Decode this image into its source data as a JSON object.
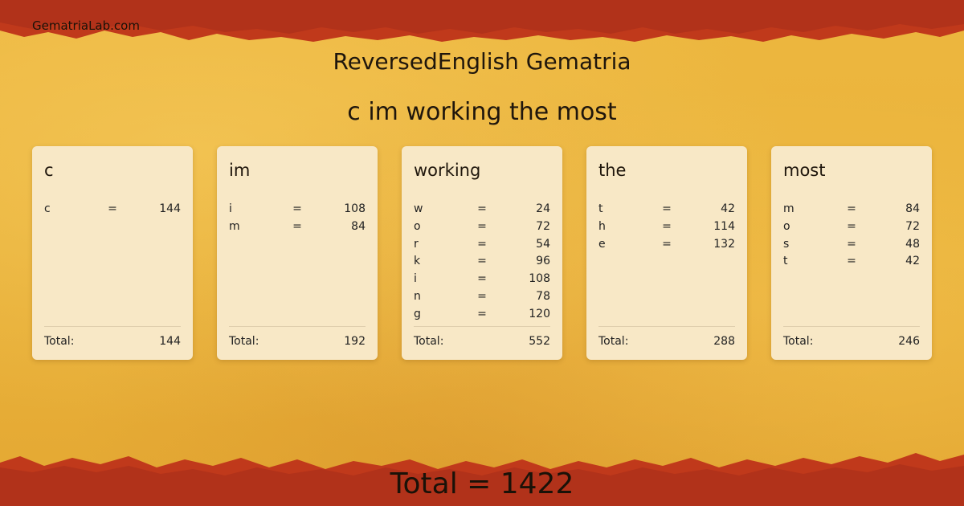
{
  "site": "GematriaLab.com",
  "title": "ReversedEnglish Gematria",
  "phrase": "c im working the most",
  "words": [
    {
      "word": "c",
      "letters": [
        {
          "l": "c",
          "v": "144"
        }
      ],
      "total_label": "Total:",
      "total": "144"
    },
    {
      "word": "im",
      "letters": [
        {
          "l": "i",
          "v": "108"
        },
        {
          "l": "m",
          "v": "84"
        }
      ],
      "total_label": "Total:",
      "total": "192"
    },
    {
      "word": "working",
      "letters": [
        {
          "l": "w",
          "v": "24"
        },
        {
          "l": "o",
          "v": "72"
        },
        {
          "l": "r",
          "v": "54"
        },
        {
          "l": "k",
          "v": "96"
        },
        {
          "l": "i",
          "v": "108"
        },
        {
          "l": "n",
          "v": "78"
        },
        {
          "l": "g",
          "v": "120"
        }
      ],
      "total_label": "Total:",
      "total": "552"
    },
    {
      "word": "the",
      "letters": [
        {
          "l": "t",
          "v": "42"
        },
        {
          "l": "h",
          "v": "114"
        },
        {
          "l": "e",
          "v": "132"
        }
      ],
      "total_label": "Total:",
      "total": "288"
    },
    {
      "word": "most",
      "letters": [
        {
          "l": "m",
          "v": "84"
        },
        {
          "l": "o",
          "v": "72"
        },
        {
          "l": "s",
          "v": "48"
        },
        {
          "l": "t",
          "v": "42"
        }
      ],
      "total_label": "Total:",
      "total": "246"
    }
  ],
  "equals": "=",
  "grand_total": "Total = 1422",
  "colors": {
    "edge_red": "#c0391b",
    "background_gold": "#e9b23a",
    "card": "#f8e8c6"
  }
}
